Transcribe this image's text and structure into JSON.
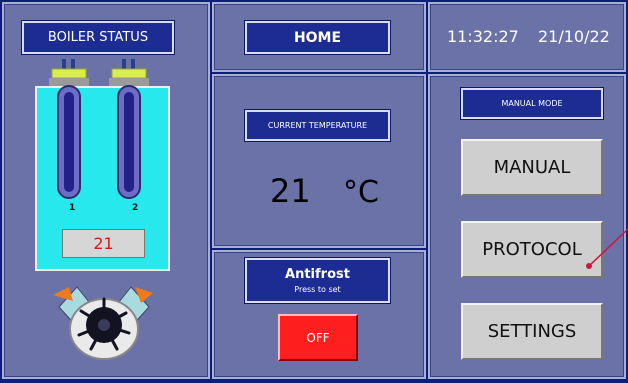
{
  "boiler": {
    "title": "BOILER STATUS",
    "heater1_label": "1",
    "heater2_label": "2",
    "level_value": "21"
  },
  "header": {
    "home_label": "HOME",
    "time": "11:32:27",
    "date": "21/10/22"
  },
  "temperature": {
    "label": "CURRENT TEMPERATURE",
    "value": "21",
    "unit": "°C"
  },
  "antifrost": {
    "title": "Antifrost",
    "subtitle": "Press to set",
    "toggle_label": "OFF"
  },
  "mode": {
    "label": "MANUAL MODE",
    "buttons": [
      "MANUAL",
      "PROTOCOL",
      "SETTINGS"
    ]
  },
  "colors": {
    "background": "#0d1f7a",
    "panel": "#6b72a8",
    "water": "#27e8ec",
    "off_button": "#ff1f1f",
    "pointer_line": "#d0143c"
  }
}
